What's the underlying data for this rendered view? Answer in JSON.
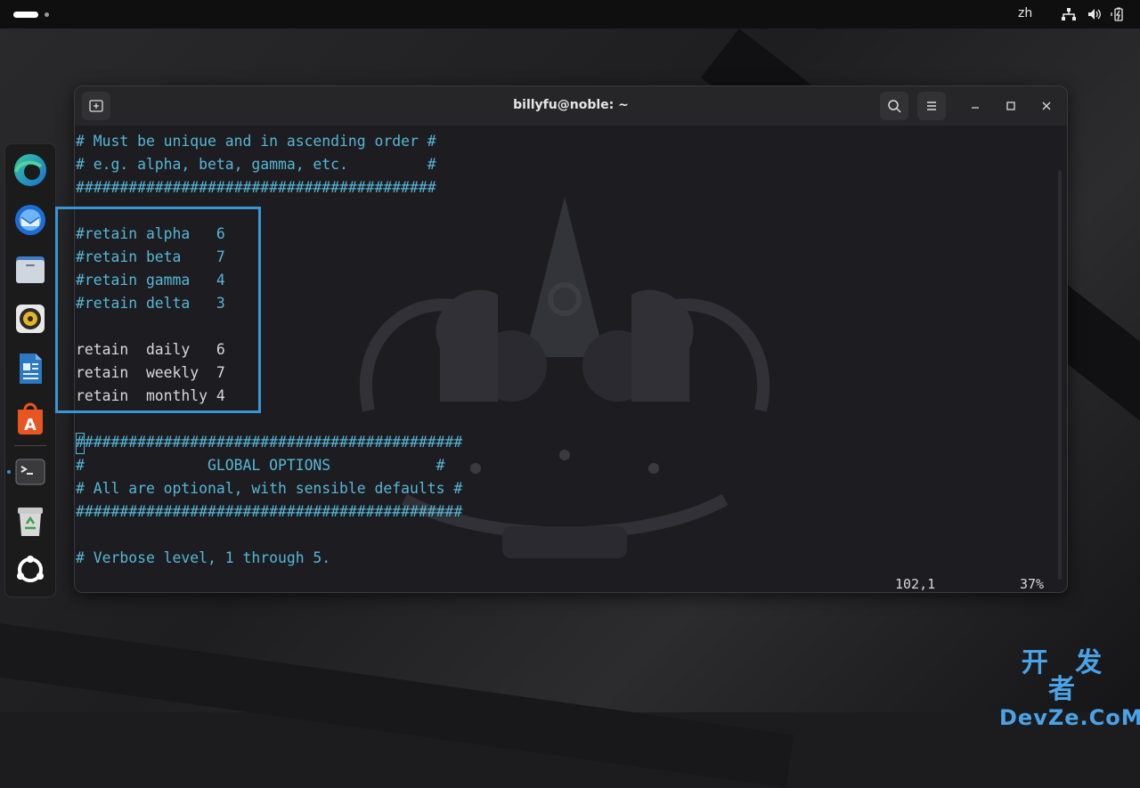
{
  "topbar": {
    "language": "zh",
    "icons": [
      "network-icon",
      "volume-icon",
      "battery-icon"
    ]
  },
  "dock": {
    "apps": [
      "Microsoft Edge",
      "Thunderbird",
      "Files",
      "Rhythmbox",
      "LibreOffice Writer",
      "App Center",
      "Terminal",
      "Trash",
      "Show Apps"
    ]
  },
  "window": {
    "title": "billyfu@noble: ~",
    "buttons": [
      "new-tab-icon",
      "search-icon",
      "menu-icon",
      "minimize-icon",
      "maximize-icon",
      "close-icon"
    ]
  },
  "terminal": {
    "lines": [
      "# Must be unique and in ascending order #",
      "# e.g. alpha, beta, gamma, etc.         #",
      "#########################################",
      "",
      "#retain alpha   6",
      "#retain beta    7",
      "#retain gamma   4",
      "#retain delta   3",
      "",
      "retain  daily   6",
      "retain  weekly  7",
      "retain  monthly 4",
      "",
      "############################################",
      "#              GLOBAL OPTIONS            #",
      "# All are optional, with sensible defaults #",
      "############################################",
      "",
      "# Verbose level, 1 through 5."
    ],
    "cursor_position": "102,1",
    "scroll_percent": "37%"
  },
  "watermark": {
    "cn": "开 发 者",
    "en": "DevZe.CoM"
  },
  "colors": {
    "comment": "#56b6d6",
    "text": "#d8d8d8",
    "highlight": "#3a95d6"
  }
}
